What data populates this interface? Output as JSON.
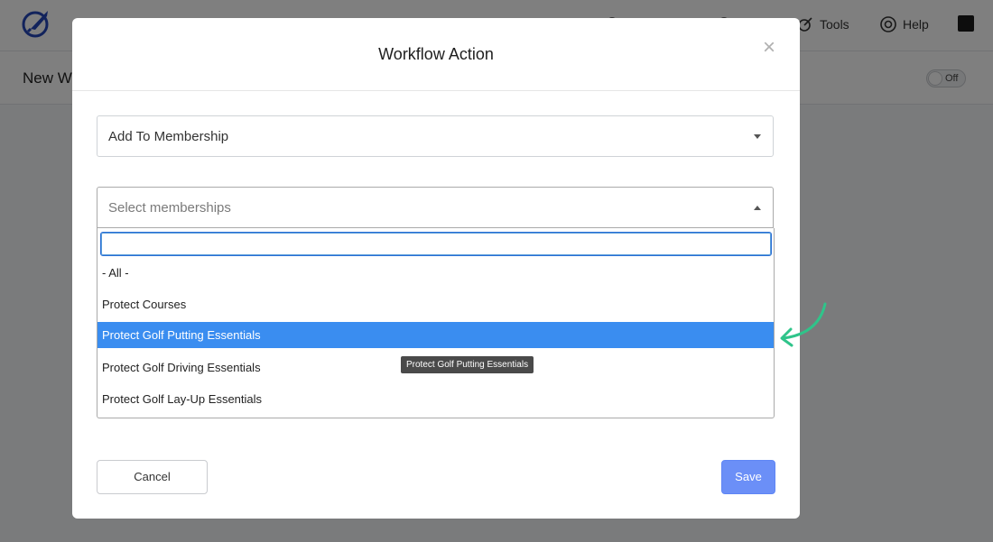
{
  "app": {
    "nav": {
      "tools_label": "Tools",
      "help_label": "Help"
    },
    "page_title": "New W",
    "toggle_label": "Off"
  },
  "modal": {
    "title": "Workflow Action",
    "close_glyph": "×",
    "action_select": {
      "value": "Add To Membership"
    },
    "membership_select": {
      "placeholder": "Select memberships",
      "search_value": "",
      "options": [
        {
          "label": "- All -",
          "highlighted": false
        },
        {
          "label": "Protect Courses",
          "highlighted": false
        },
        {
          "label": "Protect Golf Putting Essentials",
          "highlighted": true
        },
        {
          "label": "Protect Golf Driving Essentials",
          "highlighted": false
        },
        {
          "label": "Protect Golf Lay-Up Essentials",
          "highlighted": false
        }
      ]
    },
    "tooltip": "Protect Golf Putting Essentials",
    "cancel_label": "Cancel",
    "save_label": "Save"
  },
  "colors": {
    "highlight": "#3a8df0",
    "save_button": "#6b8ff7",
    "annotation_arrow": "#2fc48a",
    "logo": "#2547b8"
  },
  "icons": [
    "rocket-logo-icon",
    "tools-icon",
    "lifebuoy-help-icon",
    "fullscreen-icon",
    "close-icon",
    "caret-icon",
    "annotation-arrow-icon"
  ]
}
